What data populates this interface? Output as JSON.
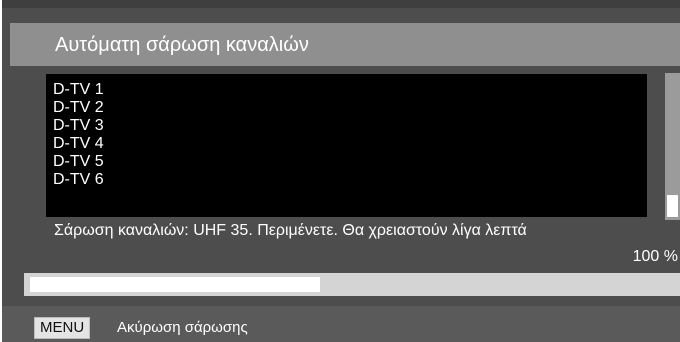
{
  "header": {
    "title": "Αυτόματη σάρωση καναλιών"
  },
  "channels": [
    "D-TV 1",
    "D-TV 2",
    "D-TV 3",
    "D-TV 4",
    "D-TV 5",
    "D-TV 6"
  ],
  "scan": {
    "status": "Σάρωση καναλιών: UHF 35. Περιμένετε. Θα χρειαστούν λίγα λεπτά",
    "percent_label": "100 %",
    "progress_bar_fraction": 0.45
  },
  "footer": {
    "menu_key": "MENU",
    "action_label": "Ακύρωση σάρωσης"
  },
  "colors": {
    "background": "#4d4d4d",
    "title_bar": "#8f8f8f",
    "list_background": "#000000",
    "progress_fill": "#ffffff"
  }
}
